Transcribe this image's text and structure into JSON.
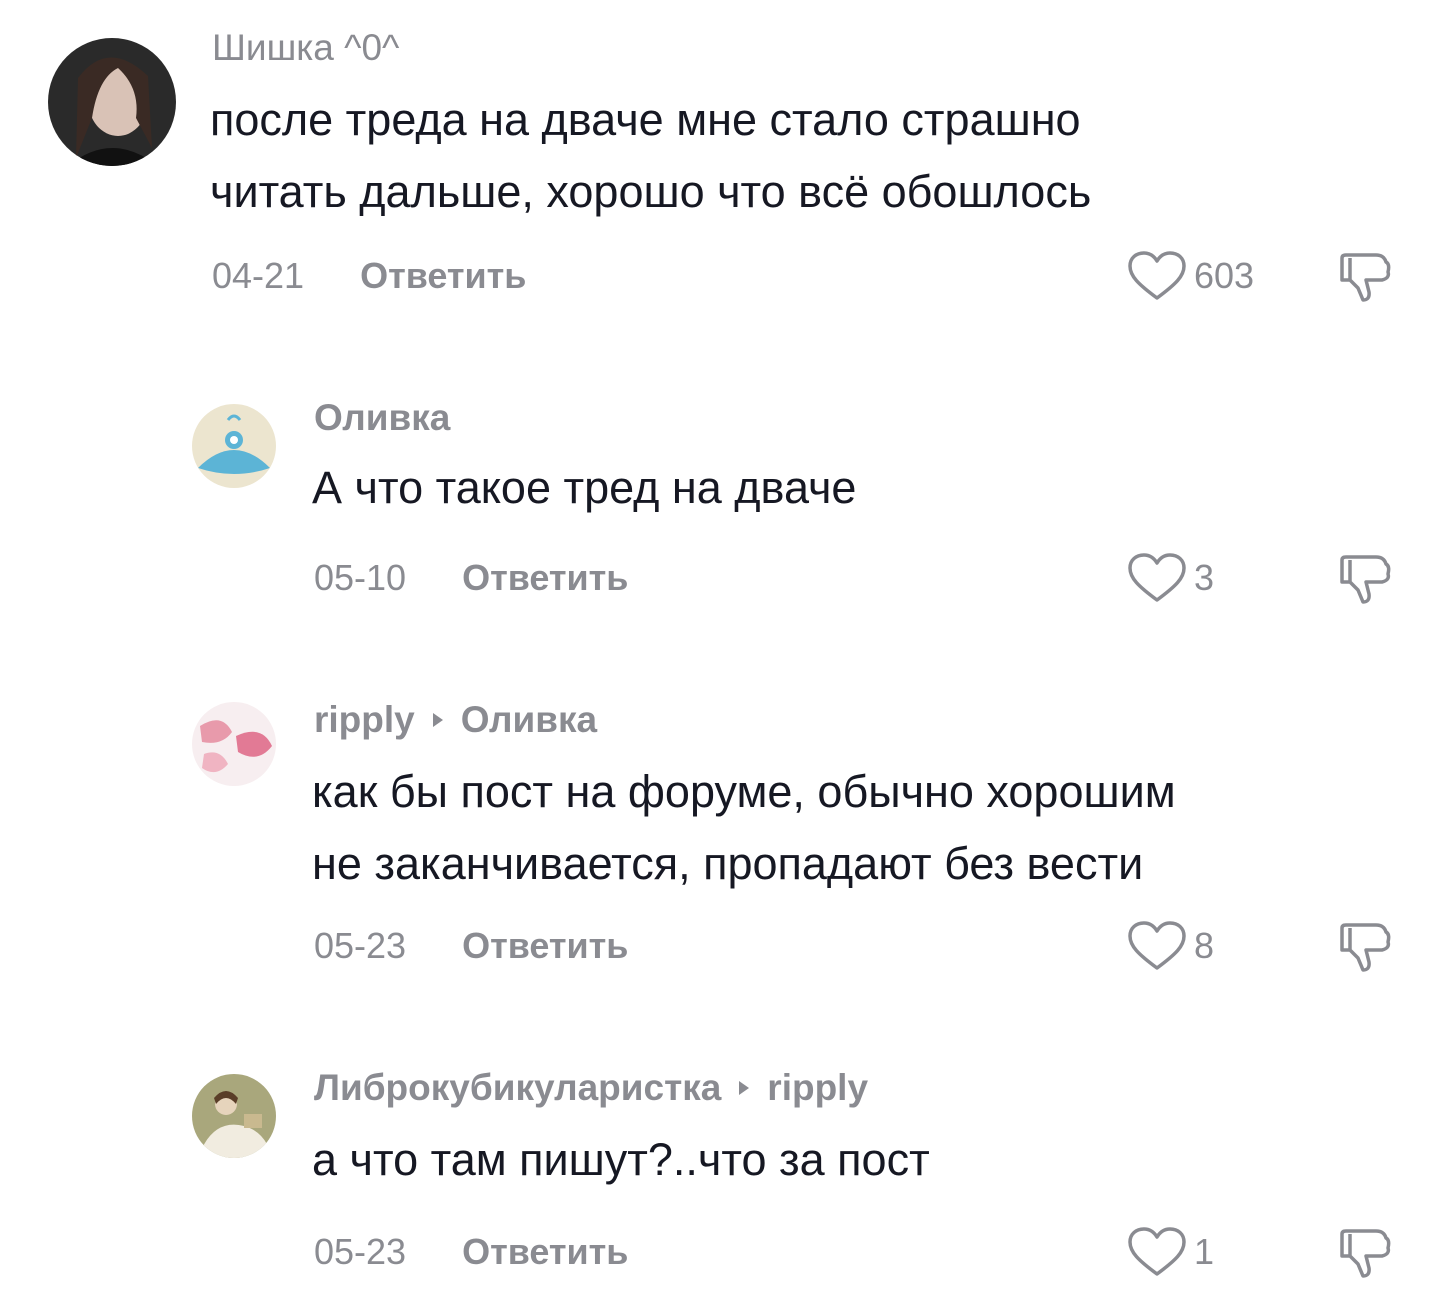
{
  "comments": [
    {
      "username": "Шишка ^0^",
      "reply_to": "",
      "text": "после треда на дваче мне стало страшно\nчитать дальше, хорошо что всё обошлось",
      "date": "04-21",
      "reply_label": "Ответить",
      "likes": "603"
    },
    {
      "username": "Оливка",
      "reply_to": "",
      "text": "А что такое тред на дваче",
      "date": "05-10",
      "reply_label": "Ответить",
      "likes": "3"
    },
    {
      "username": "ripply",
      "reply_to": "Оливка",
      "text": "как бы пост на форуме, обычно хорошим\nне заканчивается, пропадают без вести",
      "date": "05-23",
      "reply_label": "Ответить",
      "likes": "8"
    },
    {
      "username": "Либрокубикуларистка",
      "reply_to": "ripply",
      "text": "а что там пишут?..что за пост",
      "date": "05-23",
      "reply_label": "Ответить",
      "likes": "1"
    }
  ],
  "colors": {
    "text": "#161823",
    "muted": "#8a8b91",
    "background": "#ffffff"
  },
  "icons": {
    "like": "heart-outline-icon",
    "dislike": "thumbs-down-outline-icon",
    "reply_arrow": "triangle-right-icon"
  }
}
